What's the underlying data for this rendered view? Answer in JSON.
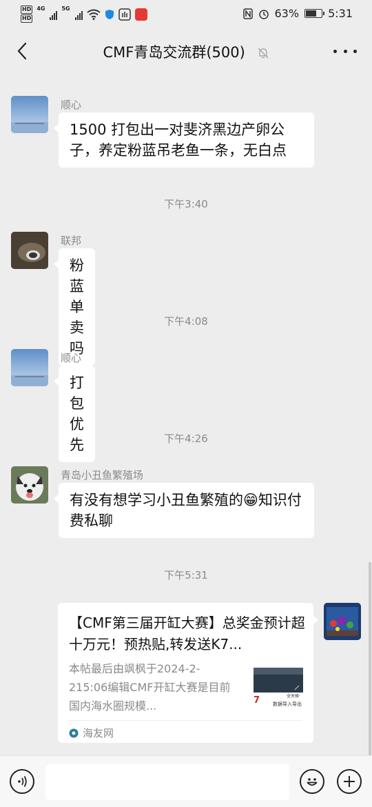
{
  "status_bar": {
    "hd1": "HD",
    "hd2": "HD",
    "net1": "4G",
    "net2": "5G",
    "battery": "63%",
    "time": "5:31"
  },
  "header": {
    "title": "CMF青岛交流群(500)"
  },
  "messages": [
    {
      "sender": "顺心",
      "text": "1500 打包出一对斐济黑边产卵公子，养定粉蓝吊老鱼一条，无白点"
    },
    {
      "time": "下午3:40"
    },
    {
      "sender": "联邦",
      "text": "粉蓝单卖吗"
    },
    {
      "time": "下午4:08"
    },
    {
      "sender": "顺心",
      "text": "打包优先"
    },
    {
      "time": "下午4:26"
    },
    {
      "sender": "青岛小丑鱼繁殖场",
      "text": "有没有想学习小丑鱼繁殖的😁知识付费私聊"
    },
    {
      "time": "下午5:31"
    }
  ],
  "link_card": {
    "title": "【CMF第三届开缸大赛】总奖金预计超十万元！预热贴,转发送K7...",
    "description": "本帖最后由飒枫于2024-2-215:06编辑CMF开缸大赛是目前国内海水圈规模...",
    "source": "海友网",
    "thumb_text_1": "7",
    "thumb_text_2": "数据导入导出",
    "thumb_text_3": "全天候·"
  },
  "input": {
    "placeholder": ""
  },
  "colors": {
    "background": "#ededed",
    "bubble": "#ffffff",
    "meta_text": "#8a8a8a",
    "input_bar": "#f7f7f7"
  }
}
